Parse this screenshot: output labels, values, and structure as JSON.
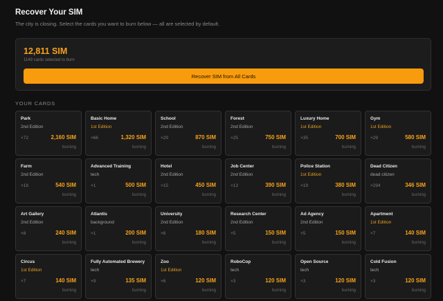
{
  "header": {
    "title": "Recover Your SIM",
    "subtitle": "The city is closing. Select the cards you want to burn below — all are selected by default."
  },
  "summary": {
    "total": "12,811 SIM",
    "selected_text": "1149 cards selected to burn",
    "button_label": "Recover SIM from All Cards"
  },
  "section": {
    "label": "YOUR CARDS"
  },
  "colors": {
    "accent": "#f89c0e",
    "first_edition": "#e8a021",
    "background": "#111111",
    "card": "#1b1b1b"
  },
  "cards": [
    {
      "name": "Park",
      "sub": "2nd Edition",
      "count": "×72",
      "sim": "2,160 SIM",
      "state": "burning",
      "first": false
    },
    {
      "name": "Basic Home",
      "sub": "1st Edition",
      "count": "×66",
      "sim": "1,320 SIM",
      "state": "burning",
      "first": true
    },
    {
      "name": "School",
      "sub": "2nd Edition",
      "count": "×29",
      "sim": "870 SIM",
      "state": "burning",
      "first": false
    },
    {
      "name": "Forest",
      "sub": "2nd Edition",
      "count": "×25",
      "sim": "750 SIM",
      "state": "burning",
      "first": false
    },
    {
      "name": "Luxury Home",
      "sub": "1st Edition",
      "count": "×35",
      "sim": "700 SIM",
      "state": "burning",
      "first": true
    },
    {
      "name": "Gym",
      "sub": "1st Edition",
      "count": "×29",
      "sim": "580 SIM",
      "state": "burning",
      "first": true
    },
    {
      "name": "Farm",
      "sub": "2nd Edition",
      "count": "×18",
      "sim": "540 SIM",
      "state": "burning",
      "first": false
    },
    {
      "name": "Advanced Training",
      "sub": "tech",
      "count": "×1",
      "sim": "500 SIM",
      "state": "burning",
      "first": false
    },
    {
      "name": "Hotel",
      "sub": "2nd Edition",
      "count": "×15",
      "sim": "450 SIM",
      "state": "burning",
      "first": false
    },
    {
      "name": "Job Center",
      "sub": "2nd Edition",
      "count": "×13",
      "sim": "390 SIM",
      "state": "burning",
      "first": false
    },
    {
      "name": "Police Station",
      "sub": "1st Edition",
      "count": "×19",
      "sim": "380 SIM",
      "state": "burning",
      "first": true
    },
    {
      "name": "Dead Citizen",
      "sub": "dead citizen",
      "count": "×294",
      "sim": "346 SIM",
      "state": "burning",
      "first": false
    },
    {
      "name": "Art Gallery",
      "sub": "2nd Edition",
      "count": "×8",
      "sim": "240 SIM",
      "state": "burning",
      "first": false
    },
    {
      "name": "Atlantis",
      "sub": "background",
      "count": "×1",
      "sim": "200 SIM",
      "state": "burning",
      "first": false
    },
    {
      "name": "University",
      "sub": "2nd Edition",
      "count": "×6",
      "sim": "180 SIM",
      "state": "burning",
      "first": false
    },
    {
      "name": "Research Center",
      "sub": "2nd Edition",
      "count": "×5",
      "sim": "150 SIM",
      "state": "burning",
      "first": false
    },
    {
      "name": "Ad Agency",
      "sub": "2nd Edition",
      "count": "×5",
      "sim": "150 SIM",
      "state": "burning",
      "first": false
    },
    {
      "name": "Apartment",
      "sub": "1st Edition",
      "count": "×7",
      "sim": "140 SIM",
      "state": "burning",
      "first": true
    },
    {
      "name": "Circus",
      "sub": "1st Edition",
      "count": "×7",
      "sim": "140 SIM",
      "state": "burning",
      "first": true
    },
    {
      "name": "Fully Automated Brewery",
      "sub": "tech",
      "count": "×9",
      "sim": "135 SIM",
      "state": "burning",
      "first": false
    },
    {
      "name": "Zoo",
      "sub": "1st Edition",
      "count": "×6",
      "sim": "120 SIM",
      "state": "burning",
      "first": true
    },
    {
      "name": "RoboCop",
      "sub": "tech",
      "count": "×3",
      "sim": "120 SIM",
      "state": "burning",
      "first": false
    },
    {
      "name": "Open Source",
      "sub": "tech",
      "count": "×3",
      "sim": "120 SIM",
      "state": "burning",
      "first": false
    },
    {
      "name": "Cold Fusion",
      "sub": "tech",
      "count": "×3",
      "sim": "120 SIM",
      "state": "burning",
      "first": false
    }
  ]
}
